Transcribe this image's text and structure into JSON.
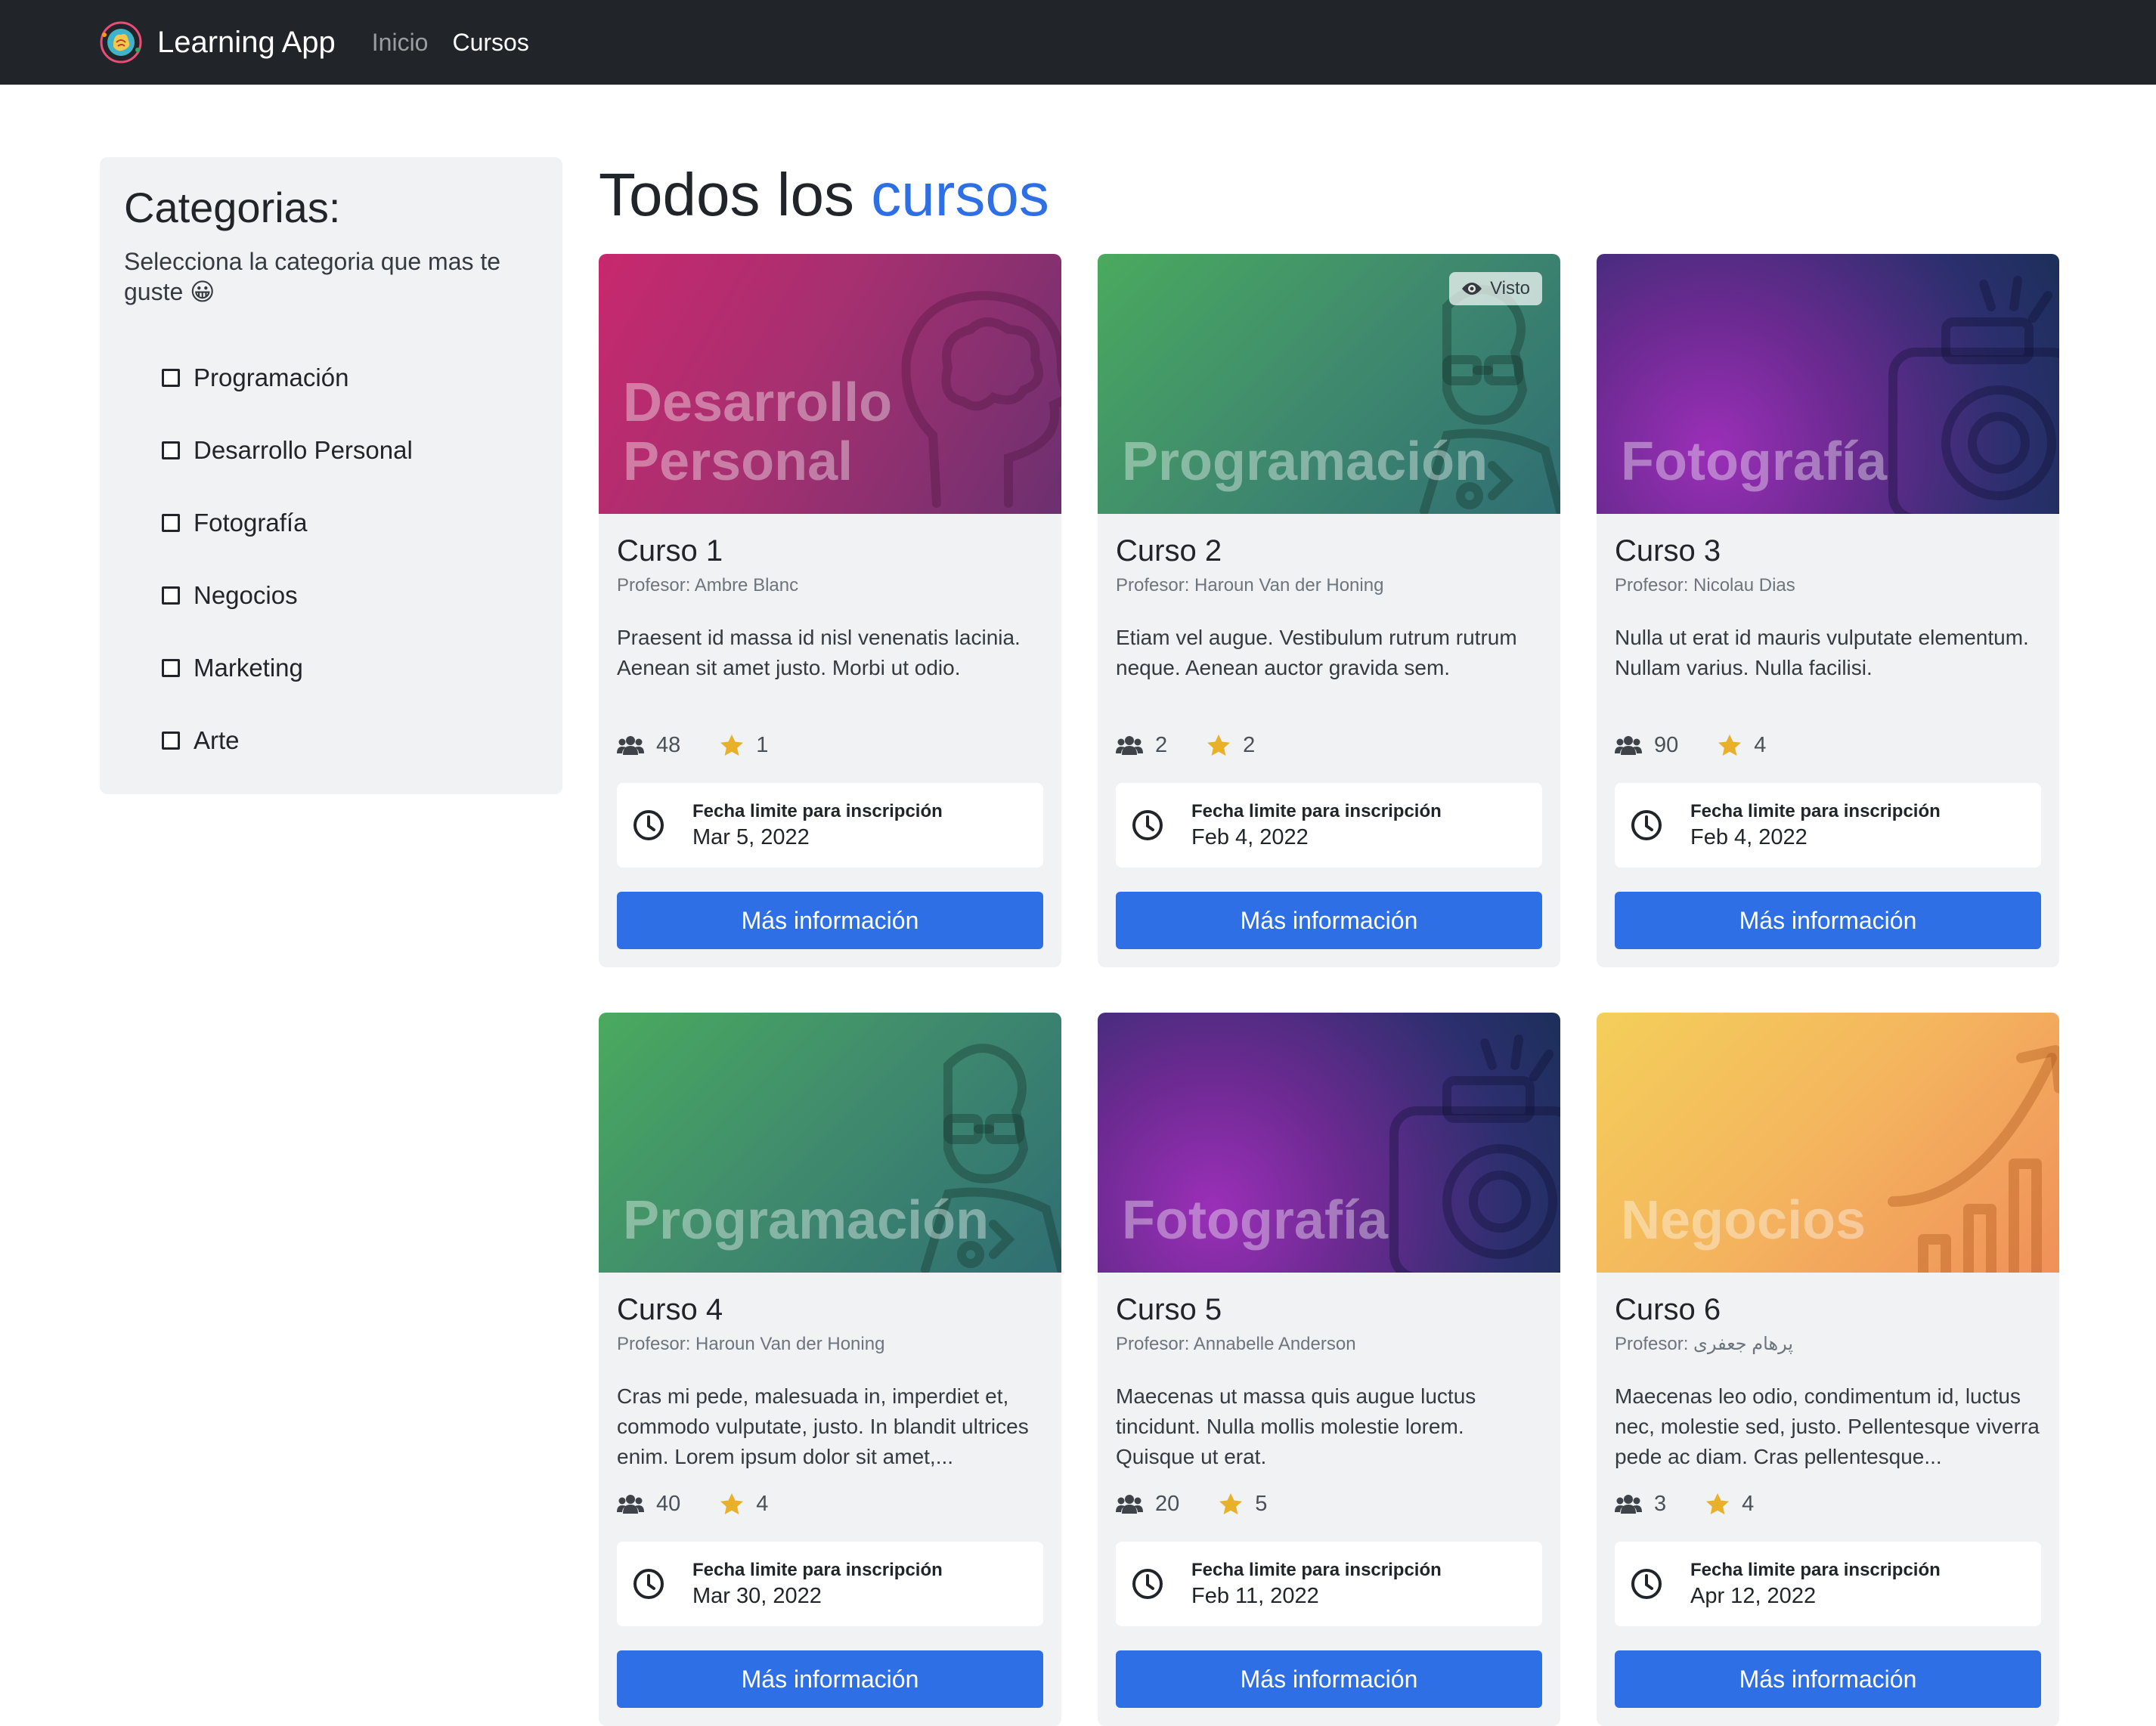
{
  "navbar": {
    "brand": "Learning App",
    "links": [
      {
        "label": "Inicio",
        "active": false
      },
      {
        "label": "Cursos",
        "active": true
      }
    ]
  },
  "sidebar": {
    "title": "Categorias:",
    "subtitle": "Selecciona la categoria que mas te guste 😀",
    "categories": [
      "Programación",
      "Desarrollo Personal",
      "Fotografía",
      "Negocios",
      "Marketing",
      "Arte"
    ]
  },
  "main": {
    "title_prefix": "Todos los",
    "title_accent": "cursos"
  },
  "card_common": {
    "deadline_label": "Fecha limite para inscripción",
    "button_label": "Más información",
    "seen_label": "Visto"
  },
  "colors": {
    "accent": "#2f6fe6",
    "navbar": "#212529",
    "star": "#e9b02a"
  },
  "courses": [
    {
      "title": "Curso 1",
      "teacher": "Profesor: Ambre Blanc",
      "category_label": "Desarrollo Personal",
      "category_icon": "brain-head-icon",
      "description": "Praesent id massa id nisl venenatis lacinia. Aenean sit amet justo. Morbi ut odio.",
      "students": "48",
      "rating": "1",
      "deadline": "Mar 5, 2022",
      "seen": false
    },
    {
      "title": "Curso 2",
      "teacher": "Profesor: Haroun Van der Honing",
      "category_label": "Programación",
      "category_icon": "programmer-icon",
      "description": "Etiam vel augue. Vestibulum rutrum rutrum neque. Aenean auctor gravida sem.",
      "students": "2",
      "rating": "2",
      "deadline": "Feb 4, 2022",
      "seen": true
    },
    {
      "title": "Curso 3",
      "teacher": "Profesor: Nicolau Dias",
      "category_label": "Fotografía",
      "category_icon": "camera-icon",
      "description": "Nulla ut erat id mauris vulputate elementum. Nullam varius. Nulla facilisi.",
      "students": "90",
      "rating": "4",
      "deadline": "Feb 4, 2022",
      "seen": false
    },
    {
      "title": "Curso 4",
      "teacher": "Profesor: Haroun Van der Honing",
      "category_label": "Programación",
      "category_icon": "programmer-icon",
      "description": "Cras mi pede, malesuada in, imperdiet et, commodo vulputate, justo. In blandit ultrices enim. Lorem ipsum dolor sit amet,...",
      "students": "40",
      "rating": "4",
      "deadline": "Mar 30, 2022",
      "seen": false
    },
    {
      "title": "Curso 5",
      "teacher": "Profesor: Annabelle Anderson",
      "category_label": "Fotografía",
      "category_icon": "camera-icon",
      "description": "Maecenas ut massa quis augue luctus tincidunt. Nulla mollis molestie lorem. Quisque ut erat.",
      "students": "20",
      "rating": "5",
      "deadline": "Feb 11, 2022",
      "seen": false
    },
    {
      "title": "Curso 6",
      "teacher": "Profesor: پرهام جعفری",
      "category_label": "Negocios",
      "category_icon": "growth-chart-icon",
      "description": "Maecenas leo odio, condimentum id, luctus nec, molestie sed, justo. Pellentesque viverra pede ac diam. Cras pellentesque...",
      "students": "3",
      "rating": "4",
      "deadline": "Apr 12, 2022",
      "seen": false
    }
  ]
}
